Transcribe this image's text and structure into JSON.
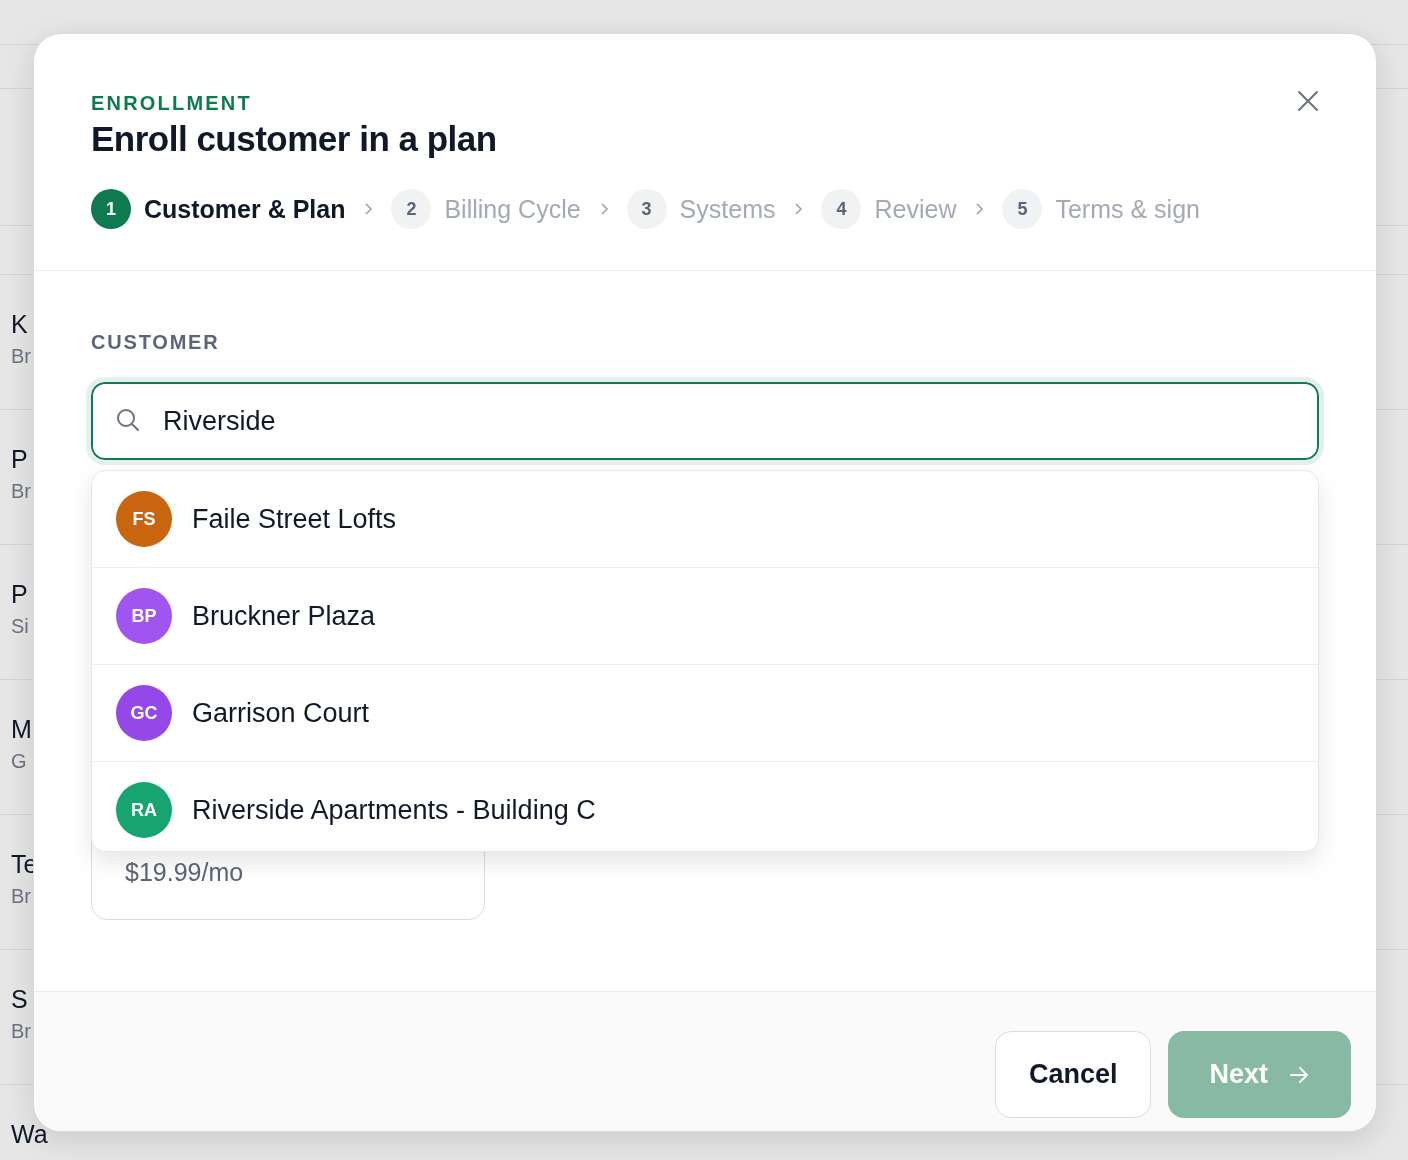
{
  "background_list": {
    "rows": [
      {
        "title": "K",
        "subtitle": "Br"
      },
      {
        "title": "P",
        "subtitle": "Br"
      },
      {
        "title": "P",
        "subtitle": "Si"
      },
      {
        "title": "M",
        "subtitle": "G"
      },
      {
        "title": "Te",
        "subtitle": "Br"
      },
      {
        "title": "S",
        "subtitle": "Br"
      },
      {
        "title": "Wa"
      }
    ]
  },
  "dialog": {
    "eyebrow": "ENROLLMENT",
    "title": "Enroll customer in a plan",
    "steps": [
      {
        "number": "1",
        "label": "Customer & Plan",
        "selected": true
      },
      {
        "number": "2",
        "label": "Billing Cycle",
        "selected": false
      },
      {
        "number": "3",
        "label": "Systems",
        "selected": false
      },
      {
        "number": "4",
        "label": "Review",
        "selected": false
      },
      {
        "number": "5",
        "label": "Terms & sign",
        "selected": false
      }
    ],
    "customer": {
      "label": "CUSTOMER",
      "search": {
        "value": "Riverside"
      },
      "results": [
        {
          "initials": "FS",
          "name": "Faile Street Lofts",
          "color": "#c8650e"
        },
        {
          "initials": "BP",
          "name": "Bruckner Plaza",
          "color": "#a155f0"
        },
        {
          "initials": "GC",
          "name": "Garrison Court",
          "color": "#9547e8"
        },
        {
          "initials": "RA",
          "name": "Riverside Apartments - Building C",
          "color": "#16a571"
        }
      ]
    },
    "plan_card": {
      "price": "$19.99/mo"
    },
    "footer": {
      "buttons": [
        {
          "label": "Cancel",
          "kind": "secondary",
          "disabled": false
        },
        {
          "label": "Next",
          "kind": "primary",
          "disabled": true
        }
      ]
    }
  }
}
